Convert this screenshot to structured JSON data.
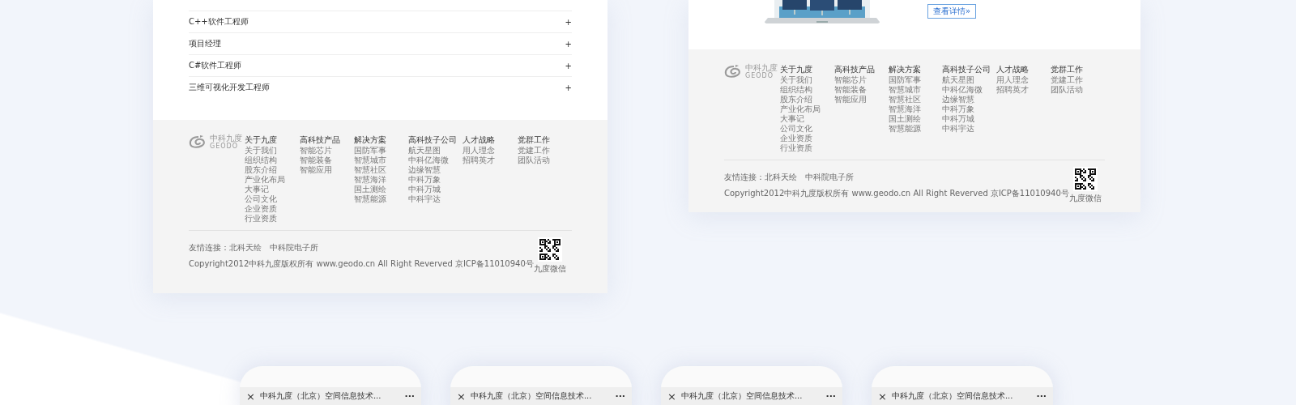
{
  "job_list": {
    "jobs": [
      {
        "title": "C++软件工程师",
        "expand_icon": "+"
      },
      {
        "title": "项目经理",
        "expand_icon": "+"
      },
      {
        "title": "C#软件工程师",
        "expand_icon": "+"
      },
      {
        "title": "三维可视化开发工程师",
        "expand_icon": "+"
      }
    ]
  },
  "left_footer": {
    "logo": {
      "name": "中科九度",
      "latin": "GEODO"
    },
    "columns": [
      {
        "heading": "关于九度",
        "links": [
          "关于我们",
          "组织结构",
          "股东介绍",
          "产业化布局",
          "大事记",
          "公司文化",
          "企业资质",
          "行业资质"
        ]
      },
      {
        "heading": "高科技产品",
        "links": [
          "智能芯片",
          "智能装备",
          "智能应用"
        ]
      },
      {
        "heading": "解决方案",
        "links": [
          "国防军事",
          "智慧城市",
          "智慧社区",
          "智慧海洋",
          "国土测绘",
          "智慧能源"
        ]
      },
      {
        "heading": "高科技子公司",
        "links": [
          "航天星图",
          "中科亿海微",
          "边缘智慧",
          "中科万象",
          "中科万城",
          "中科宇达"
        ]
      },
      {
        "heading": "人才战略",
        "links": [
          "用人理念",
          "招聘英才"
        ]
      },
      {
        "heading": "党群工作",
        "links": [
          "党建工作",
          "团队活动"
        ]
      }
    ],
    "friend_links_label": "友情连接：",
    "friend_links": [
      "北科天绘",
      "中科院电子所"
    ],
    "copyright": "Copyright2012中科九度版权所有 www.geodo.cn All Right Reverved 京ICP备11010940号",
    "qr_caption": "九度微信"
  },
  "product_detail": {
    "button": "查看详情»"
  },
  "right_footer": {
    "logo": {
      "name": "中科九度",
      "latin": "GEODO"
    },
    "columns": [
      {
        "heading": "关于九度",
        "links": [
          "关于我们",
          "组织结构",
          "股东介绍",
          "产业化布局",
          "大事记",
          "公司文化",
          "企业资质",
          "行业资质"
        ]
      },
      {
        "heading": "高科技产品",
        "links": [
          "智能芯片",
          "智能装备",
          "智能应用"
        ]
      },
      {
        "heading": "解决方案",
        "links": [
          "国防军事",
          "智慧城市",
          "智慧社区",
          "智慧海洋",
          "国土测绘",
          "智慧能源"
        ]
      },
      {
        "heading": "高科技子公司",
        "links": [
          "航天星图",
          "中科亿海微",
          "边缘智慧",
          "中科万象",
          "中科万城",
          "中科宇达"
        ]
      },
      {
        "heading": "人才战略",
        "links": [
          "用人理念",
          "招聘英才"
        ]
      },
      {
        "heading": "党群工作",
        "links": [
          "党建工作",
          "团队活动"
        ]
      }
    ],
    "friend_links_label": "友情连接：",
    "friend_links": [
      "北科天绘",
      "中科院电子所"
    ],
    "copyright": "Copyright2012中科九度版权所有 www.geodo.cn All Right Reverved 京ICP备11010940号",
    "qr_caption": "九度微信"
  },
  "mobile_previews": [
    {
      "close": "×",
      "title": "中科九度（北京）空间信息技术...",
      "more": "···"
    },
    {
      "close": "×",
      "title": "中科九度（北京）空间信息技术...",
      "more": "···"
    },
    {
      "close": "×",
      "title": "中科九度（北京）空间信息技术...",
      "more": "···"
    },
    {
      "close": "×",
      "title": "中科九度（北京）空间信息技术...",
      "more": "···"
    }
  ]
}
